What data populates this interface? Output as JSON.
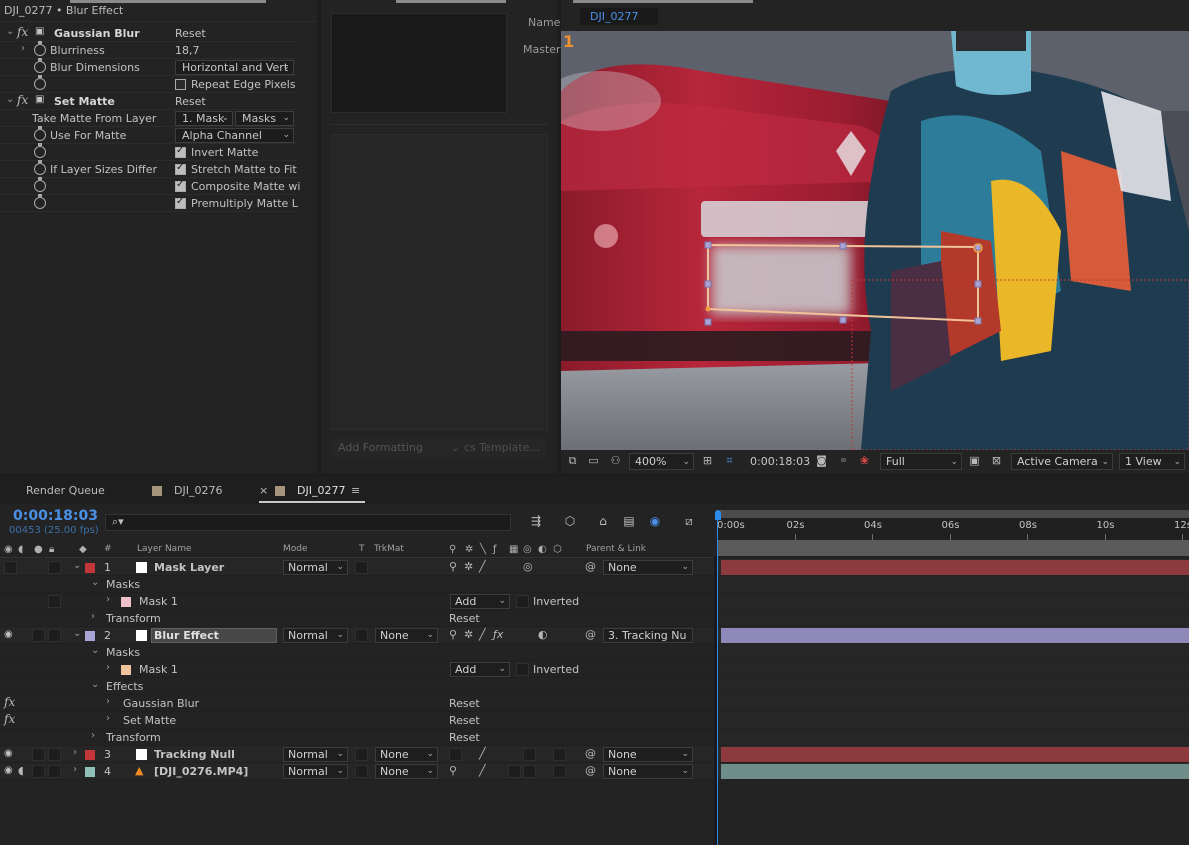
{
  "effect_controls": {
    "title": "DJI_0277 • Blur Effect",
    "gaussian_blur": {
      "name": "Gaussian Blur",
      "reset": "Reset",
      "blurriness_label": "Blurriness",
      "blurriness_value": "18,7",
      "blur_dimensions_label": "Blur Dimensions",
      "blur_dimensions_value": "Horizontal and Vert",
      "repeat_edge_label": "Repeat Edge Pixels"
    },
    "set_matte": {
      "name": "Set Matte",
      "reset": "Reset",
      "take_matte_label": "Take Matte From Layer",
      "take_matte_layer": "1. Mask",
      "take_matte_source": "Masks",
      "use_for_matte_label": "Use For Matte",
      "use_for_matte_value": "Alpha Channel",
      "invert_matte": "Invert Matte",
      "if_sizes_differ_label": "If Layer Sizes Differ",
      "stretch_matte": "Stretch Matte to Fit",
      "composite_matte": "Composite Matte wi",
      "premultiply_matte": "Premultiply Matte L"
    }
  },
  "middle_panel": {
    "name_label": "Name",
    "master_label": "Master",
    "add_formatting": "Add Formatting",
    "templates": "cs Template..."
  },
  "viewer": {
    "comp_tab": "DJI_0277",
    "layer_marker": "1",
    "zoom": "400%",
    "timecode": "0:00:18:03",
    "resolution": "Full",
    "camera": "Active Camera",
    "views": "1 View"
  },
  "timeline": {
    "tabs": [
      "Render Queue",
      "DJI_0276",
      "DJI_0277"
    ],
    "close_glyph": "×",
    "menu_glyph": "≡",
    "timecode": "0:00:18:03",
    "fps": "00453 (25.00 fps)",
    "ruler_labels": [
      "0:00s",
      "02s",
      "04s",
      "06s",
      "08s",
      "10s",
      "12s"
    ],
    "columns": {
      "hash": "#",
      "layer_name": "Layer Name",
      "mode": "Mode",
      "t": "T",
      "trkmat": "TrkMat",
      "parent": "Parent & Link"
    },
    "rows": {
      "r1_num": "1",
      "r1_name": "Mask Layer",
      "r1_mode": "Normal",
      "r1_parent": "None",
      "masks": "Masks",
      "mask1": "Mask 1",
      "add": "Add",
      "inverted": "Inverted",
      "transform": "Transform",
      "reset": "Reset",
      "r2_num": "2",
      "r2_name": "Blur Effect",
      "r2_mode": "Normal",
      "r2_trkmat": "None",
      "r2_parent": "3. Tracking Nu",
      "effects": "Effects",
      "gaussian": "Gaussian Blur",
      "setmatte": "Set Matte",
      "r3_num": "3",
      "r3_name": "Tracking Null",
      "r3_mode": "Normal",
      "r3_trkmat": "None",
      "r3_parent": "None",
      "r4_num": "4",
      "r4_name": "[DJI_0276.MP4]",
      "r4_mode": "Normal",
      "r4_trkmat": "None",
      "r4_parent": "None"
    }
  },
  "colors": {
    "accent_blue": "#4a90e8",
    "label_red": "#c2383a",
    "label_lavender": "#a9a3d6",
    "label_teal": "#8fc1b8",
    "mask_pink": "#f0c2c8",
    "mask_peach": "#f0c49a",
    "cti_blue": "#2d8ceb"
  }
}
